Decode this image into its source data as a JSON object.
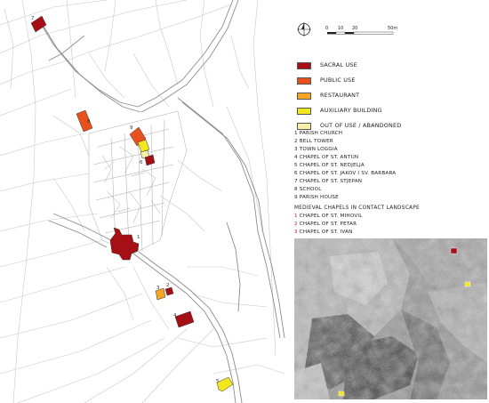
{
  "colors": {
    "sacral": "#a50f15",
    "public": "#e8501e",
    "restaurant": "#f5a623",
    "auxiliary": "#f2e61e",
    "abandoned": "#f8f0a8",
    "road": "#9a9a9a",
    "parcel": "#c8c8c8"
  },
  "north_arrow": {
    "icon": "north-arrow-icon"
  },
  "scale_bar": {
    "ticks": [
      "0",
      "10",
      "20"
    ],
    "end_label": "50m"
  },
  "legend": [
    {
      "label": "SACRAL USE",
      "color": "#a50f15"
    },
    {
      "label": "PUBLIC USE",
      "color": "#e8501e"
    },
    {
      "label": "RESTAURANT",
      "color": "#f5a623"
    },
    {
      "label": "AUXILIARY BUILDING",
      "color": "#f2e61e"
    },
    {
      "label": "OUT OF USE / ABANDONED",
      "color": "#f8f0a8"
    }
  ],
  "building_list": [
    "1 PARISH CHURCH",
    "2 BELL TOWER",
    "3 TOWN LOGGIA",
    "4 CHAPEL OF ST. ANTUN",
    "5 CHAPEL OF ST. NEDJELJA",
    "6 CHAPEL OF ST. JAKOV I SV. BARBARA",
    "7 CHAPEL OF ST. STJEPAN",
    "8 SCHOOL",
    "9 PARISH HOUSE"
  ],
  "medieval_chapels": {
    "title": "MEDIEVAL CHAPELS IN CONTACT LANDSCAPE",
    "items": [
      {
        "num": "1",
        "label": "CHAPEL OF ST. MIHOVIL"
      },
      {
        "num": "2",
        "label": "CHAPEL OF ST. PETAR"
      },
      {
        "num": "3",
        "label": "CHAPEL OF ST. IVAN"
      }
    ]
  },
  "map_labels": {
    "b1": "1",
    "b2": "2",
    "b3": "3",
    "b4": "4",
    "b5": "5",
    "b6": "6",
    "b7": "7",
    "b8": "8",
    "b9": "9"
  }
}
